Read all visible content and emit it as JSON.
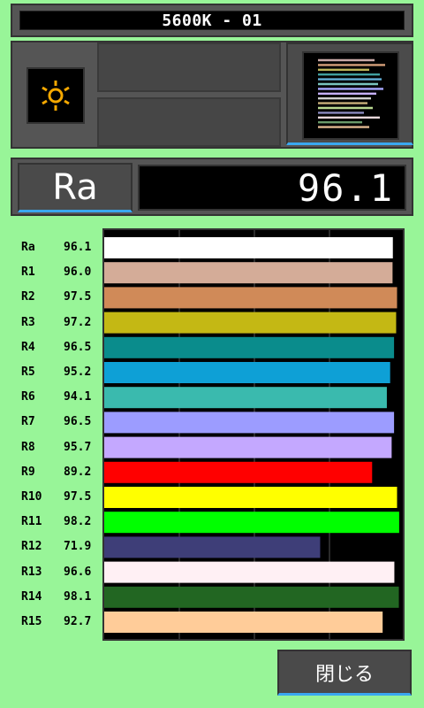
{
  "header": {
    "title": "5600K - 01"
  },
  "icons": {
    "light_source": "sun-icon",
    "spectrum": "spectrum-thumbnail-icon"
  },
  "ra_display": {
    "label": "Ra",
    "value": "96.1"
  },
  "chart_data": {
    "type": "bar",
    "orientation": "horizontal",
    "categories": [
      "Ra",
      "R1",
      "R2",
      "R3",
      "R4",
      "R5",
      "R6",
      "R7",
      "R8",
      "R9",
      "R10",
      "R11",
      "R12",
      "R13",
      "R14",
      "R15"
    ],
    "values": [
      96.1,
      96.0,
      97.5,
      97.2,
      96.5,
      95.2,
      94.1,
      96.5,
      95.7,
      89.2,
      97.5,
      98.2,
      71.9,
      96.6,
      98.1,
      92.7
    ],
    "value_labels": [
      "96.1",
      "96.0",
      "97.5",
      "97.2",
      "96.5",
      "95.2",
      "94.1",
      "96.5",
      "95.7",
      "89.2",
      "97.5",
      "98.2",
      "71.9",
      "96.6",
      "98.1",
      "92.7"
    ],
    "colors": [
      "#ffffff",
      "#d4ac98",
      "#d08a58",
      "#c4b814",
      "#0a8c8c",
      "#0ea0d6",
      "#3abaae",
      "#9c9cff",
      "#c4a8ff",
      "#ff0000",
      "#ffff00",
      "#00ff00",
      "#3e3e78",
      "#fff0f4",
      "#226622",
      "#ffcc99"
    ],
    "xlim": [
      0,
      100
    ],
    "grid": true,
    "gridlines": [
      25,
      50,
      75
    ]
  },
  "spectrum_lines": [
    {
      "color": "#c9a9a6"
    },
    {
      "color": "#d6a07a"
    },
    {
      "color": "#bdb65a"
    },
    {
      "color": "#3f9f9f"
    },
    {
      "color": "#64b0d8"
    },
    {
      "color": "#7ac4bd"
    },
    {
      "color": "#a8a8ff"
    },
    {
      "color": "#c6b0ff"
    },
    {
      "color": "#d0d0d0"
    },
    {
      "color": "#c8b07a"
    },
    {
      "color": "#b8d890"
    },
    {
      "color": "#8a8ac0"
    },
    {
      "color": "#e8d8dc"
    },
    {
      "color": "#6a9a6a"
    },
    {
      "color": "#e0b890"
    }
  ],
  "buttons": {
    "close_label": "閉じる"
  }
}
